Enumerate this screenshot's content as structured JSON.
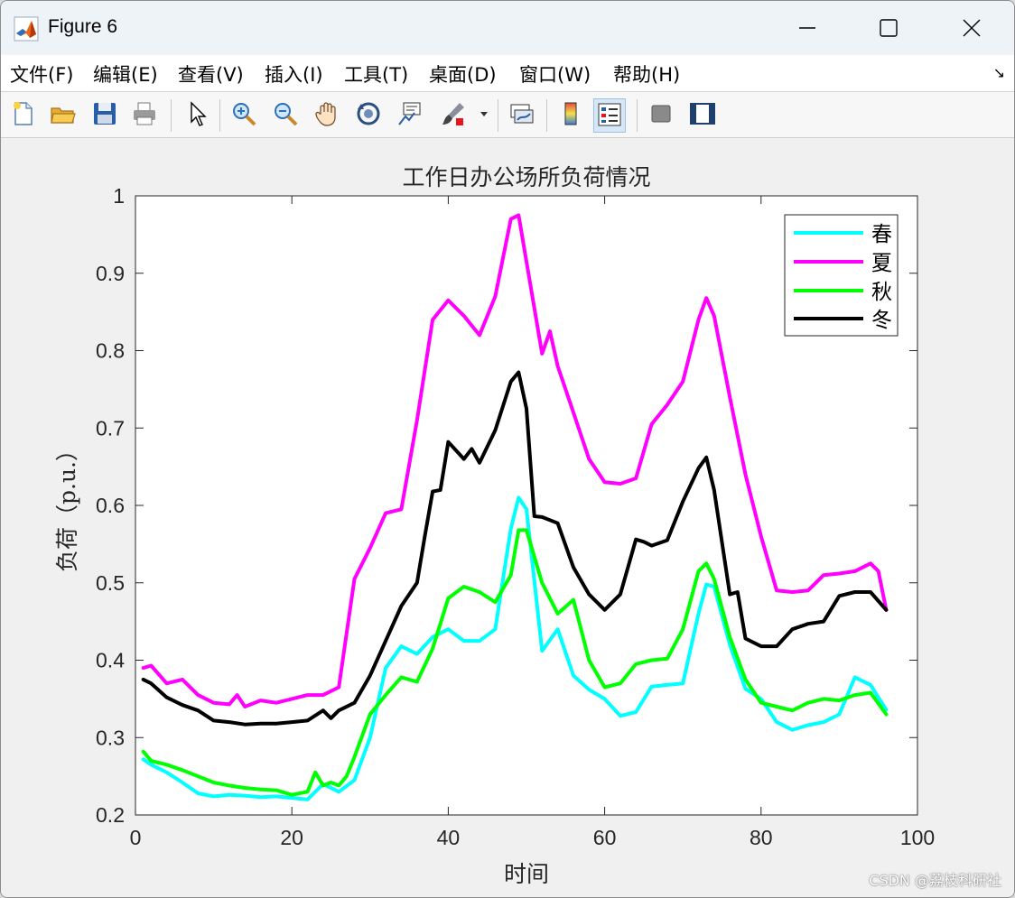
{
  "window": {
    "title": "Figure 6"
  },
  "menu": [
    {
      "label": "文件(F)",
      "name": "menu-file"
    },
    {
      "label": "编辑(E)",
      "name": "menu-edit"
    },
    {
      "label": "查看(V)",
      "name": "menu-view"
    },
    {
      "label": "插入(I)",
      "name": "menu-insert"
    },
    {
      "label": "工具(T)",
      "name": "menu-tools"
    },
    {
      "label": "桌面(D)",
      "name": "menu-desktop"
    },
    {
      "label": "窗口(W)",
      "name": "menu-window"
    },
    {
      "label": "帮助(H)",
      "name": "menu-help"
    }
  ],
  "toolbar": {
    "tools": [
      "new-figure-icon",
      "open-icon",
      "save-icon",
      "print-icon",
      "select-arrow-icon",
      "zoom-in-icon",
      "zoom-out-icon",
      "pan-hand-icon",
      "rotate-3d-icon",
      "data-cursor-icon",
      "brush-icon",
      "dropdown-arrow-icon",
      "link-plot-icon",
      "colorbar-icon",
      "legend-icon",
      "hide-plot-tools-icon",
      "show-plot-tools-icon"
    ]
  },
  "colors": {
    "spring": "#00ffff",
    "summer": "#ff00ff",
    "autumn": "#00ff00",
    "winter": "#000000"
  },
  "watermark": "CSDN @荔枝科研社",
  "chart_data": {
    "type": "line",
    "title": "工作日办公场所负荷情况",
    "xlabel": "时间",
    "ylabel": "负荷（p.u.）",
    "xlim": [
      0,
      100
    ],
    "ylim": [
      0.2,
      1.0
    ],
    "xticks": [
      0,
      20,
      40,
      60,
      80,
      100
    ],
    "yticks": [
      0.2,
      0.3,
      0.4,
      0.5,
      0.6,
      0.7,
      0.8,
      0.9,
      1.0
    ],
    "ytick_labels": [
      "0.2",
      "0.3",
      "0.4",
      "0.5",
      "0.6",
      "0.7",
      "0.8",
      "0.9",
      "1"
    ],
    "grid": false,
    "legend": "top-right",
    "series": [
      {
        "name": "春",
        "color": "#00ffff",
        "x": [
          1,
          2,
          4,
          6,
          8,
          10,
          12,
          14,
          16,
          18,
          20,
          22,
          24,
          26,
          28,
          30,
          32,
          34,
          36,
          38,
          40,
          42,
          44,
          46,
          48,
          49,
          50,
          52,
          54,
          56,
          58,
          60,
          62,
          64,
          66,
          68,
          70,
          72,
          73,
          74,
          76,
          78,
          80,
          82,
          84,
          86,
          88,
          90,
          92,
          94,
          96
        ],
        "y": [
          0.272,
          0.265,
          0.255,
          0.242,
          0.228,
          0.224,
          0.226,
          0.225,
          0.223,
          0.224,
          0.222,
          0.22,
          0.24,
          0.23,
          0.245,
          0.3,
          0.39,
          0.418,
          0.408,
          0.43,
          0.44,
          0.425,
          0.425,
          0.44,
          0.57,
          0.61,
          0.595,
          0.412,
          0.44,
          0.38,
          0.362,
          0.35,
          0.328,
          0.333,
          0.366,
          0.368,
          0.37,
          0.46,
          0.498,
          0.495,
          0.42,
          0.363,
          0.35,
          0.32,
          0.31,
          0.316,
          0.32,
          0.33,
          0.378,
          0.368,
          0.336
        ]
      },
      {
        "name": "夏",
        "color": "#ff00ff",
        "x": [
          1,
          2,
          4,
          6,
          8,
          10,
          12,
          13,
          14,
          16,
          18,
          20,
          22,
          24,
          26,
          28,
          30,
          32,
          34,
          36,
          38,
          40,
          42,
          44,
          46,
          48,
          49,
          50,
          52,
          53,
          54,
          56,
          58,
          60,
          62,
          64,
          66,
          68,
          70,
          72,
          73,
          74,
          76,
          78,
          80,
          82,
          84,
          86,
          88,
          90,
          92,
          94,
          95,
          96
        ],
        "y": [
          0.39,
          0.393,
          0.37,
          0.375,
          0.355,
          0.345,
          0.343,
          0.355,
          0.34,
          0.348,
          0.345,
          0.35,
          0.355,
          0.355,
          0.365,
          0.505,
          0.545,
          0.59,
          0.595,
          0.71,
          0.84,
          0.865,
          0.845,
          0.82,
          0.87,
          0.97,
          0.975,
          0.915,
          0.796,
          0.825,
          0.78,
          0.72,
          0.66,
          0.63,
          0.628,
          0.635,
          0.705,
          0.73,
          0.76,
          0.84,
          0.868,
          0.845,
          0.74,
          0.64,
          0.56,
          0.49,
          0.488,
          0.49,
          0.51,
          0.512,
          0.515,
          0.525,
          0.515,
          0.465
        ]
      },
      {
        "name": "秋",
        "color": "#00ff00",
        "x": [
          1,
          2,
          4,
          6,
          8,
          10,
          12,
          14,
          16,
          18,
          20,
          22,
          23,
          24,
          25,
          26,
          27,
          28,
          30,
          32,
          34,
          36,
          38,
          40,
          42,
          44,
          46,
          48,
          49,
          50,
          52,
          54,
          56,
          58,
          60,
          62,
          64,
          66,
          68,
          70,
          72,
          73,
          74,
          76,
          78,
          80,
          82,
          84,
          86,
          88,
          90,
          92,
          94,
          96
        ],
        "y": [
          0.282,
          0.27,
          0.265,
          0.258,
          0.25,
          0.242,
          0.238,
          0.235,
          0.233,
          0.232,
          0.226,
          0.23,
          0.255,
          0.238,
          0.242,
          0.238,
          0.25,
          0.275,
          0.33,
          0.355,
          0.378,
          0.372,
          0.415,
          0.48,
          0.495,
          0.488,
          0.475,
          0.51,
          0.568,
          0.568,
          0.5,
          0.46,
          0.478,
          0.4,
          0.365,
          0.37,
          0.395,
          0.4,
          0.402,
          0.44,
          0.515,
          0.525,
          0.505,
          0.43,
          0.375,
          0.345,
          0.34,
          0.335,
          0.345,
          0.35,
          0.348,
          0.355,
          0.358,
          0.33
        ]
      },
      {
        "name": "冬",
        "color": "#000000",
        "x": [
          1,
          2,
          4,
          6,
          8,
          10,
          12,
          14,
          16,
          18,
          20,
          22,
          24,
          25,
          26,
          28,
          30,
          32,
          34,
          36,
          37,
          38,
          39,
          40,
          42,
          43,
          44,
          46,
          48,
          49,
          50,
          51,
          52,
          54,
          56,
          58,
          60,
          62,
          64,
          65,
          66,
          68,
          70,
          72,
          73,
          74,
          76,
          77,
          78,
          80,
          82,
          84,
          86,
          88,
          90,
          92,
          94,
          96
        ],
        "y": [
          0.375,
          0.37,
          0.352,
          0.342,
          0.335,
          0.322,
          0.32,
          0.317,
          0.318,
          0.318,
          0.32,
          0.322,
          0.335,
          0.325,
          0.335,
          0.345,
          0.38,
          0.425,
          0.47,
          0.5,
          0.56,
          0.618,
          0.62,
          0.682,
          0.66,
          0.673,
          0.655,
          0.697,
          0.76,
          0.772,
          0.725,
          0.586,
          0.585,
          0.577,
          0.52,
          0.485,
          0.465,
          0.485,
          0.556,
          0.553,
          0.548,
          0.555,
          0.605,
          0.648,
          0.662,
          0.62,
          0.485,
          0.488,
          0.428,
          0.418,
          0.418,
          0.44,
          0.447,
          0.45,
          0.483,
          0.488,
          0.488,
          0.465
        ]
      }
    ]
  }
}
